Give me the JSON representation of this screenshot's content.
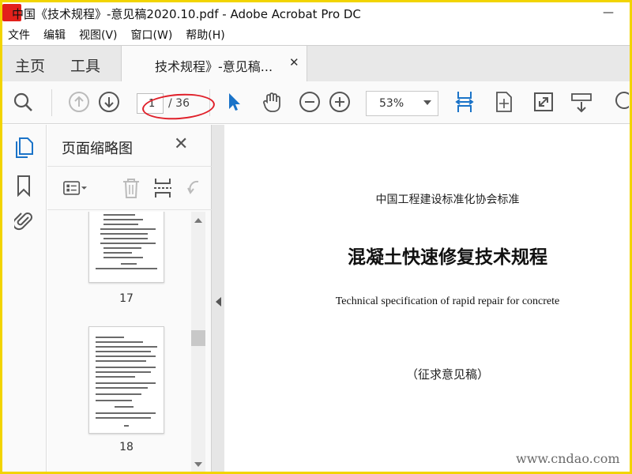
{
  "window": {
    "title": "中国《技术规程》-意见稿2020.10.pdf - Adobe Acrobat Pro DC",
    "minimize_glyph": "—"
  },
  "menu": {
    "items": [
      "文件",
      "编辑",
      "视图(V)",
      "窗口(W)",
      "帮助(H)"
    ]
  },
  "tabs": {
    "home": "主页",
    "tools": "工具",
    "document": "技术规程》-意见稿...",
    "close_glyph": "✕"
  },
  "toolbar": {
    "current_page": "1",
    "total_pages": "/ 36",
    "zoom": "53%"
  },
  "thumbnails_panel": {
    "title": "页面缩略图",
    "close_glyph": "✕",
    "pages": [
      {
        "number": "17"
      },
      {
        "number": "18"
      }
    ]
  },
  "document": {
    "organization": "中国工程建设标准化协会标准",
    "title": "混凝土快速修复技术规程",
    "english_title": "Technical specification of rapid repair for concrete",
    "draft_note": "（征求意见稿）"
  },
  "watermark": "www.cndao.com",
  "colors": {
    "border": "#f2d400",
    "accent_blue": "#1a73c8",
    "annotation_red": "#e0202a"
  }
}
